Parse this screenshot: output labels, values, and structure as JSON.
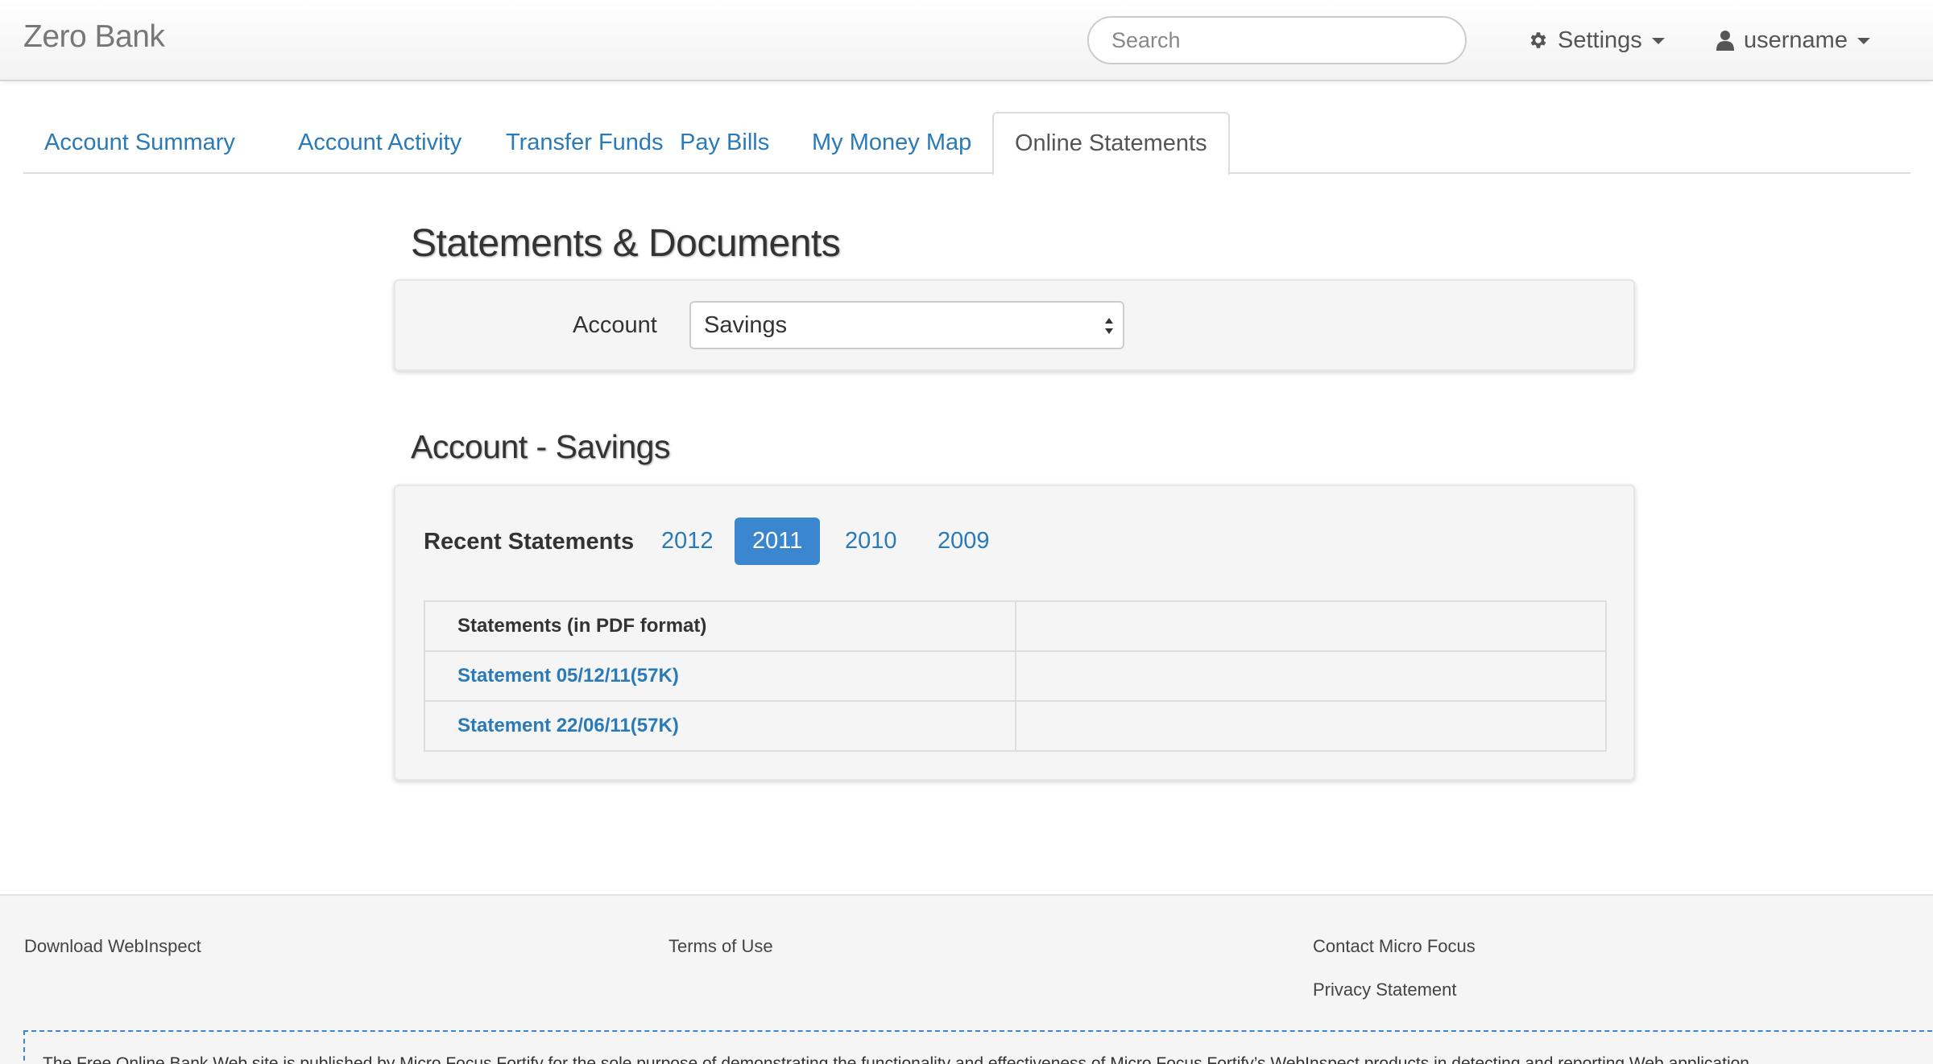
{
  "navbar": {
    "brand": "Zero Bank",
    "search_placeholder": "Search",
    "settings_label": "Settings",
    "user_label": "username"
  },
  "tabs": [
    {
      "label": "Account Summary"
    },
    {
      "label": "Account Activity"
    },
    {
      "label": "Transfer Funds"
    },
    {
      "label": "Pay Bills"
    },
    {
      "label": "My Money Map"
    },
    {
      "label": "Online Statements",
      "active": true
    }
  ],
  "main": {
    "title": "Statements & Documents",
    "account_label": "Account",
    "account_selected": "Savings",
    "subtitle": "Account - Savings",
    "recent_label": "Recent Statements",
    "years": [
      "2012",
      "2011",
      "2010",
      "2009"
    ],
    "active_year": "2011",
    "table": {
      "header": "Statements (in PDF format)",
      "rows": [
        "Statement 05/12/11(57K)",
        "Statement 22/06/11(57K)"
      ]
    }
  },
  "footer": {
    "download": "Download WebInspect",
    "terms": "Terms of Use",
    "contact": "Contact Micro Focus",
    "privacy": "Privacy Statement",
    "disclaimer": "The Free Online Bank Web site is published by Micro Focus Fortify for the sole purpose of demonstrating the functionality and effectiveness of Micro Focus Fortify’s WebInspect products in detecting and reporting Web application"
  },
  "colors": {
    "link": "#2a7ab8",
    "active_pill": "#3a87cf"
  }
}
